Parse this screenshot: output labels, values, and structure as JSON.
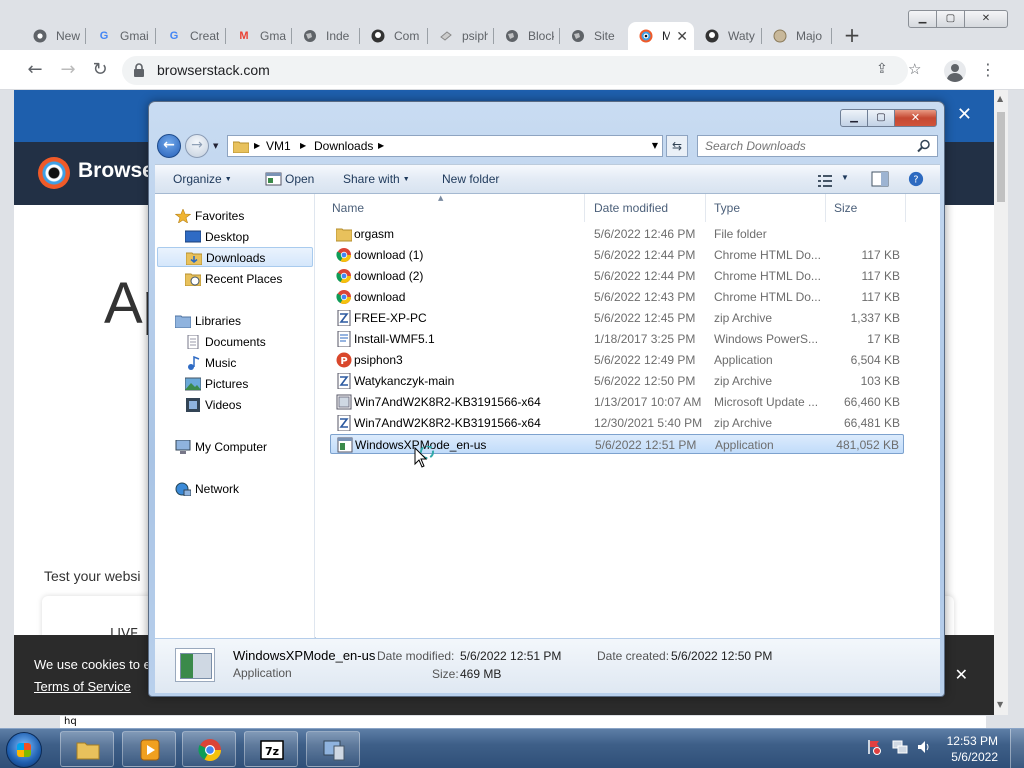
{
  "browser": {
    "tabs": [
      {
        "label": "New",
        "icon": "chrome-icon"
      },
      {
        "label": "Gmai",
        "icon": "google-icon"
      },
      {
        "label": "Creat",
        "icon": "google-icon"
      },
      {
        "label": "Gma",
        "icon": "gmail-icon"
      },
      {
        "label": "Inde",
        "icon": "globe-icon"
      },
      {
        "label": "Com",
        "icon": "github-icon"
      },
      {
        "label": "psiph",
        "icon": "file-icon"
      },
      {
        "label": "Block",
        "icon": "globe-icon"
      },
      {
        "label": "Site",
        "icon": "globe-icon"
      },
      {
        "label": "M",
        "icon": "browserstack-icon",
        "active": true
      },
      {
        "label": "Waty",
        "icon": "github-icon"
      },
      {
        "label": "Majo",
        "icon": "file-icon"
      }
    ],
    "url": "browserstack.com"
  },
  "webpage": {
    "brand": "Browse",
    "headline": "Ap",
    "test_line": "Test your websi",
    "card_text": "LIVE",
    "cookie_text": "We use cookies to e",
    "cookie_link": "Terms of Service",
    "hq_label": "hq"
  },
  "explorer": {
    "breadcrumb": [
      "VM1",
      "Downloads"
    ],
    "search_placeholder": "Search Downloads",
    "commands": {
      "organize": "Organize",
      "open": "Open",
      "share_with": "Share with",
      "new_folder": "New folder"
    },
    "nav": {
      "favorites": "Favorites",
      "desktop": "Desktop",
      "downloads": "Downloads",
      "recent_places": "Recent Places",
      "libraries": "Libraries",
      "documents": "Documents",
      "music": "Music",
      "pictures": "Pictures",
      "videos": "Videos",
      "my_computer": "My Computer",
      "network": "Network"
    },
    "columns": {
      "name": "Name",
      "date": "Date modified",
      "type": "Type",
      "size": "Size"
    },
    "files": [
      {
        "name": "orgasm",
        "date": "5/6/2022 12:46 PM",
        "type": "File folder",
        "size": "",
        "icon": "folder-icon"
      },
      {
        "name": "download (1)",
        "date": "5/6/2022 12:44 PM",
        "type": "Chrome HTML Do...",
        "size": "117 KB",
        "icon": "chrome-icon"
      },
      {
        "name": "download (2)",
        "date": "5/6/2022 12:44 PM",
        "type": "Chrome HTML Do...",
        "size": "117 KB",
        "icon": "chrome-icon"
      },
      {
        "name": "download",
        "date": "5/6/2022 12:43 PM",
        "type": "Chrome HTML Do...",
        "size": "117 KB",
        "icon": "chrome-icon"
      },
      {
        "name": "FREE-XP-PC",
        "date": "5/6/2022 12:45 PM",
        "type": "zip Archive",
        "size": "1,337 KB",
        "icon": "zip-icon"
      },
      {
        "name": "Install-WMF5.1",
        "date": "1/18/2017 3:25 PM",
        "type": "Windows PowerS...",
        "size": "17 KB",
        "icon": "script-icon"
      },
      {
        "name": "psiphon3",
        "date": "5/6/2022 12:49 PM",
        "type": "Application",
        "size": "6,504 KB",
        "icon": "psiphon-icon"
      },
      {
        "name": "Watykanczyk-main",
        "date": "5/6/2022 12:50 PM",
        "type": "zip Archive",
        "size": "103 KB",
        "icon": "zip-icon"
      },
      {
        "name": "Win7AndW2K8R2-KB3191566-x64",
        "date": "1/13/2017 10:07 AM",
        "type": "Microsoft Update ...",
        "size": "66,460 KB",
        "icon": "update-icon"
      },
      {
        "name": "Win7AndW2K8R2-KB3191566-x64",
        "date": "12/30/2021 5:40 PM",
        "type": "zip Archive",
        "size": "66,481 KB",
        "icon": "zip-icon"
      },
      {
        "name": "WindowsXPMode_en-us",
        "date": "5/6/2022 12:51 PM",
        "type": "Application",
        "size": "481,052 KB",
        "icon": "app-icon",
        "selected": true
      }
    ],
    "details": {
      "name": "WindowsXPMode_en-us",
      "type": "Application",
      "date_modified_label": "Date modified:",
      "date_modified": "5/6/2022 12:51 PM",
      "date_created_label": "Date created:",
      "date_created": "5/6/2022 12:50 PM",
      "size_label": "Size:",
      "size": "469 MB"
    }
  },
  "taskbar": {
    "time": "12:53 PM",
    "date": "5/6/2022"
  }
}
